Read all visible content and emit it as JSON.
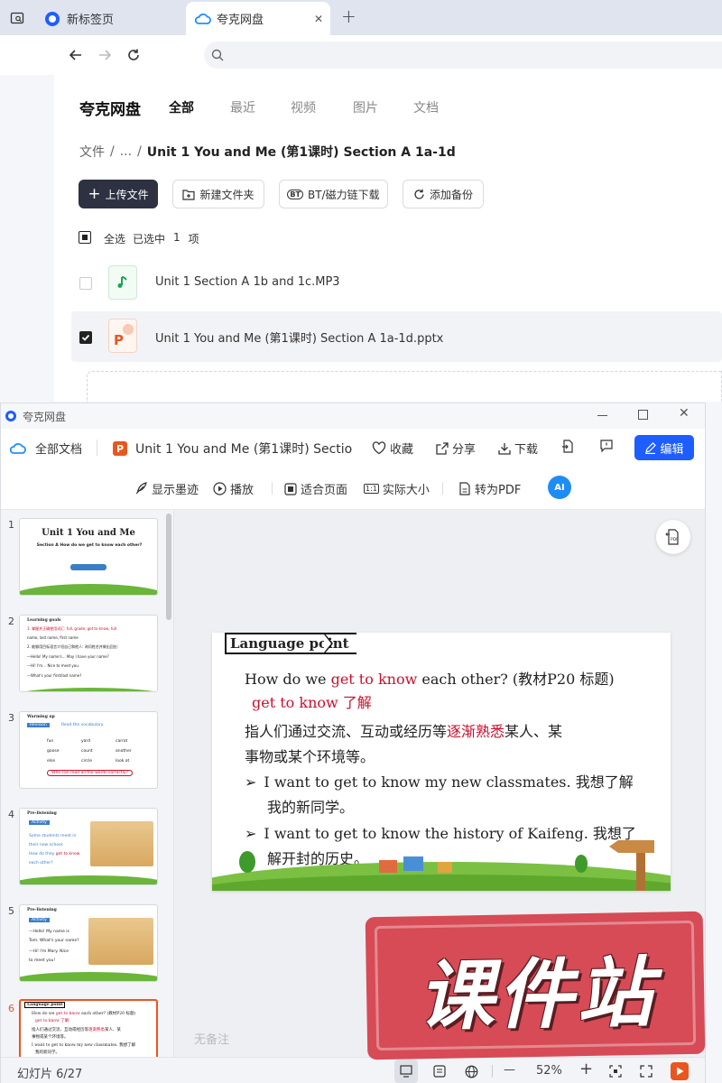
{
  "browser": {
    "tabs": [
      {
        "label": "新标签页",
        "active": false
      },
      {
        "label": "夸克网盘",
        "active": true
      }
    ],
    "new_tab": "+",
    "close": "✕"
  },
  "drive": {
    "logo": "夸克网盘",
    "nav": [
      "全部",
      "最近",
      "视频",
      "图片",
      "文档"
    ],
    "breadcrumb": {
      "root": "文件",
      "sep": "/",
      "ellipsis": "...",
      "current": "Unit 1 You and Me (第1课时) Section A 1a-1d"
    },
    "actions": {
      "upload": "上传文件",
      "new_folder": "新建文件夹",
      "bt": "BT/磁力链下载",
      "backup": "添加备份"
    },
    "select_all": "全选",
    "selected_text": "已选中",
    "selected_count": "1",
    "selected_unit": "项",
    "files": [
      {
        "name": "Unit 1 Section A 1b and 1c.MP3",
        "type": "audio",
        "checked": false
      },
      {
        "name": "Unit 1 You and Me (第1课时) Section A 1a-1d.pptx",
        "type": "pptx",
        "checked": true
      }
    ]
  },
  "viewer": {
    "window_title": "夸克网盘",
    "all_docs": "全部文档",
    "doc_title": "Unit 1 You and Me (第1课时) Sectior",
    "fav": "收藏",
    "share": "分享",
    "download": "下载",
    "edit": "编辑",
    "show_ink": "显示墨迹",
    "play": "播放",
    "fit_page": "适合页面",
    "actual_size": "实际大小",
    "to_pdf": "转为PDF",
    "ai": "AI",
    "pdf_badge": "PDF",
    "no_notes": "无备注",
    "slide_counter": "幻灯片 6/27",
    "zoom": "52%",
    "zoom_minus": "—",
    "zoom_plus": "+"
  },
  "slide": {
    "tag": "Language point",
    "line1_a": "How do we ",
    "line1_b": "get to know",
    "line1_c": " each other? (教材P20 标题)",
    "line2_a": "get to know",
    "line2_b": " 了解",
    "para_a": "指人们通过交流、互动或经历等",
    "para_b": "逐渐熟悉",
    "para_c": "某人、某",
    "para_d": "事物或某个环境等。",
    "bullet1_a": "I want to get to know my new classmates. 我想了解",
    "bullet1_b": "我的新同学。",
    "bullet2_a": "I want to get to know the history of Kaifeng. 我想了",
    "bullet2_b": "解开封的历史。",
    "bullet_glyph": "➢"
  },
  "thumbs": [
    {
      "num": "1",
      "title": "Unit 1 You and Me",
      "sub": "Section A  How do we get to know each other?"
    },
    {
      "num": "2",
      "head": "Learning goals",
      "l1": "1. 掌握并正确使用词汇: full, grade, get to know, full",
      "l2": "name, last name, first name",
      "l3": "2. 能够用目标语言介绍自己和他人: 询问姓名并做出回应:",
      "l4": "—Hello! My name's… May I have your name?",
      "l5": "—Hi! I'm… Nice to meet you.",
      "l6": "—What's your first/last name?"
    },
    {
      "num": "3",
      "head": "Warming up",
      "badge": "Revision",
      "lead": "Read the vocabulary.",
      "words": [
        "fun",
        "yard",
        "carrot",
        "goose",
        "count",
        "another",
        "else",
        "circle",
        "look at"
      ],
      "q": "Who can read all the words correctly?"
    },
    {
      "num": "4",
      "head": "Pre-listening",
      "badge": "Activity",
      "l1": "Some students meet in",
      "l2": "their new school.",
      "l3a": "How do they ",
      "l3b": "get to know",
      "l4": "each other?"
    },
    {
      "num": "5",
      "head": "Pre-listening",
      "badge": "Activity",
      "l1": "—Hello! My name is",
      "l2": "Tom. What's your name?",
      "l3": "—Hi! I'm Mary. Nice",
      "l4": "to meet you!"
    },
    {
      "num": "6",
      "head": "Language point"
    }
  ],
  "watermark": {
    "text": "课件站"
  },
  "colors": {
    "accent": "#1e5eff",
    "red": "#c8102e",
    "ppt": "#e8571f",
    "dark_btn": "#2d3142"
  }
}
